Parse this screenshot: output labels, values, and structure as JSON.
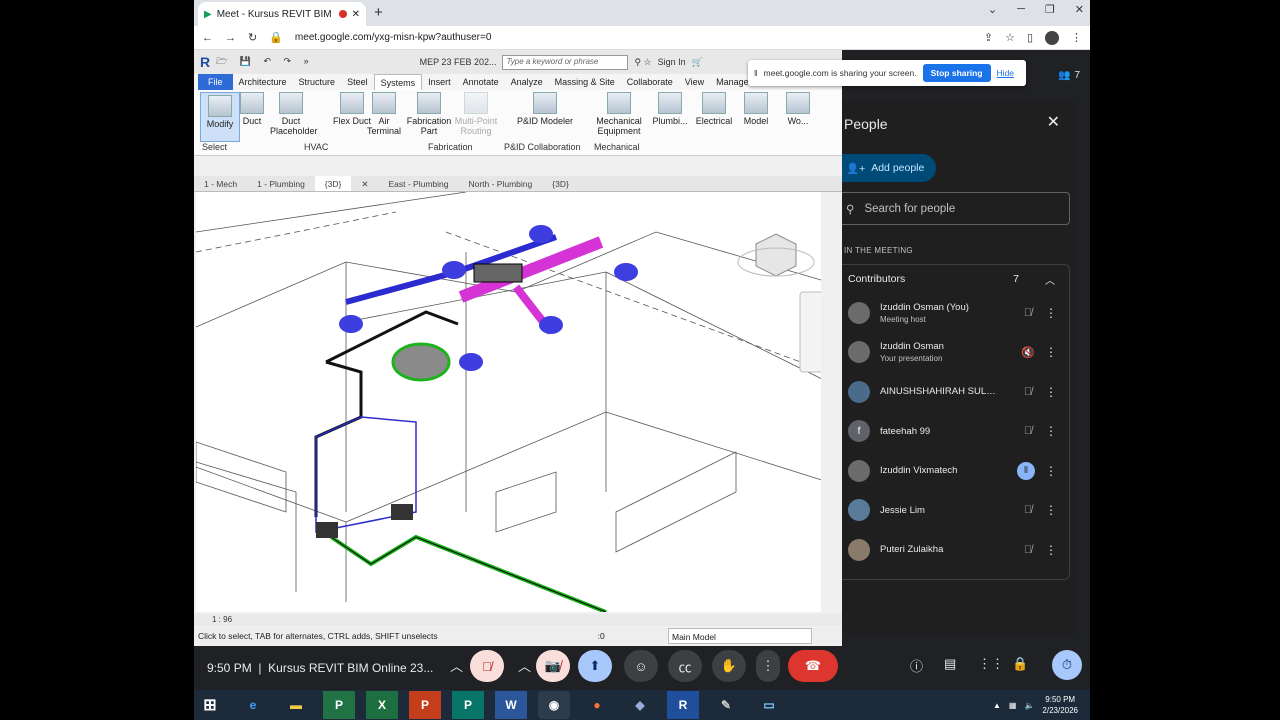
{
  "browser": {
    "tab_title": "Meet - Kursus REVIT BIM Onl",
    "url": "meet.google.com/yxg-misn-kpw?authuser=0"
  },
  "revit": {
    "project_title": "MEP 23 FEB 202...",
    "search_placeholder": "Type a keyword or phrase",
    "sign_in": "Sign In",
    "menu": [
      "File",
      "Architecture",
      "Structure",
      "Steel",
      "Systems",
      "Insert",
      "Annotate",
      "Analyze",
      "Massing & Site",
      "Collaborate",
      "View",
      "Manage"
    ],
    "ribbon_buttons": [
      "Modify",
      "Duct",
      "Duct Placeholder",
      "Flex Duct",
      "Air Terminal",
      "Fabrication Part",
      "Multi-Point Routing",
      "P&ID Modeler",
      "Mechanical Equipment",
      "Plumbi...",
      "Electrical",
      "Model",
      "Wo..."
    ],
    "groups": [
      "Select",
      "HVAC",
      "Fabrication",
      "P&ID Collaboration",
      "Mechanical"
    ],
    "view_tabs": [
      "1 - Mech",
      "1 - Plumbing",
      "{3D}",
      "East - Plumbing",
      "North - Plumbing",
      "{3D}"
    ],
    "scale": "1 : 96",
    "status_text": "Click to select, TAB for alternates, CTRL adds, SHIFT unselects",
    "zero": ":0",
    "model_select": "Main Model"
  },
  "share_banner": {
    "text": "meet.google.com is sharing your screen.",
    "stop": "Stop sharing",
    "hide": "Hide"
  },
  "participant_count": "7",
  "people": {
    "title": "People",
    "add": "Add people",
    "search_placeholder": "Search for people",
    "in_meeting": "IN THE MEETING",
    "group_label": "Contributors",
    "group_count": "7",
    "list": [
      {
        "name": "Izuddin Osman (You)",
        "sub": "Meeting host",
        "initial": ""
      },
      {
        "name": "Izuddin Osman",
        "sub": "Your presentation",
        "initial": ""
      },
      {
        "name": "AINUSHSHAHIRAH SULAI...",
        "sub": "",
        "initial": ""
      },
      {
        "name": "fateehah 99",
        "sub": "",
        "initial": "f"
      },
      {
        "name": "Izuddin Vixmatech",
        "sub": "",
        "initial": ""
      },
      {
        "name": "Jessie Lim",
        "sub": "",
        "initial": ""
      },
      {
        "name": "Puteri Zulaikha",
        "sub": "",
        "initial": ""
      }
    ]
  },
  "meeting": {
    "time": "9:50 PM",
    "title": "Kursus REVIT BIM Online 23..."
  },
  "taskbar": {
    "time": "9:50 PM",
    "date": "2/23/2026"
  }
}
